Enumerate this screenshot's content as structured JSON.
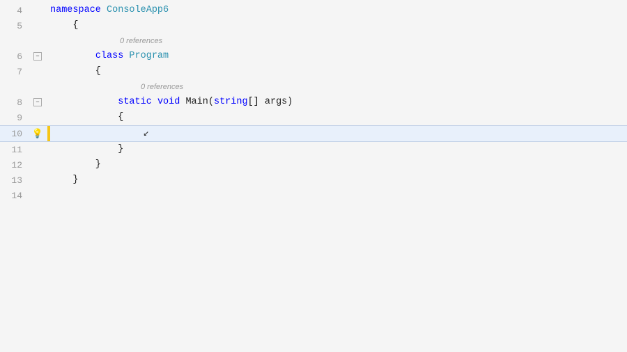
{
  "editor": {
    "background": "#f5f5f5",
    "lines": [
      {
        "number": "4",
        "type": "normal",
        "hasCollapse": false,
        "content": "namespace ConsoleApp6",
        "tokens": [
          {
            "text": "namespace ",
            "class": "kw-blue"
          },
          {
            "text": "ConsoleApp6",
            "class": "kw-namespace"
          }
        ]
      },
      {
        "number": "5",
        "type": "normal",
        "hasCollapse": false,
        "content": "    {",
        "tokens": [
          {
            "text": "    {",
            "class": "text-black"
          }
        ]
      },
      {
        "number": "6",
        "type": "hint_above",
        "hint": "0 references",
        "hasCollapse": true,
        "content": "        class Program",
        "tokens": [
          {
            "text": "        ",
            "class": ""
          },
          {
            "text": "class ",
            "class": "kw-blue"
          },
          {
            "text": "Program",
            "class": "kw-namespace"
          }
        ]
      },
      {
        "number": "7",
        "type": "normal",
        "hasCollapse": false,
        "content": "        {",
        "tokens": [
          {
            "text": "        {",
            "class": "text-black"
          }
        ]
      },
      {
        "number": "8",
        "type": "hint_above",
        "hint": "0 references",
        "hasCollapse": true,
        "content": "            static void Main(string[] args)",
        "tokens": [
          {
            "text": "            ",
            "class": ""
          },
          {
            "text": "static ",
            "class": "kw-blue"
          },
          {
            "text": "void ",
            "class": "kw-blue"
          },
          {
            "text": "Main(",
            "class": "text-black"
          },
          {
            "text": "string",
            "class": "kw-blue"
          },
          {
            "text": "[] args)",
            "class": "text-black"
          }
        ]
      },
      {
        "number": "9",
        "type": "normal",
        "hasCollapse": false,
        "content": "            {",
        "tokens": [
          {
            "text": "            {",
            "class": "text-black"
          }
        ]
      },
      {
        "number": "10",
        "type": "highlighted",
        "hasCollapse": false,
        "hasBulb": true,
        "hasYellowBar": true,
        "content": "                ",
        "tokens": []
      },
      {
        "number": "11",
        "type": "normal",
        "hasCollapse": false,
        "content": "            }",
        "tokens": [
          {
            "text": "            }",
            "class": "text-black"
          }
        ]
      },
      {
        "number": "12",
        "type": "normal",
        "hasCollapse": false,
        "content": "        }",
        "tokens": [
          {
            "text": "        }",
            "class": "text-black"
          }
        ]
      },
      {
        "number": "13",
        "type": "normal",
        "hasCollapse": false,
        "content": "    }",
        "tokens": [
          {
            "text": "    }",
            "class": "text-black"
          }
        ]
      },
      {
        "number": "14",
        "type": "normal",
        "hasCollapse": false,
        "content": "",
        "tokens": []
      }
    ]
  }
}
